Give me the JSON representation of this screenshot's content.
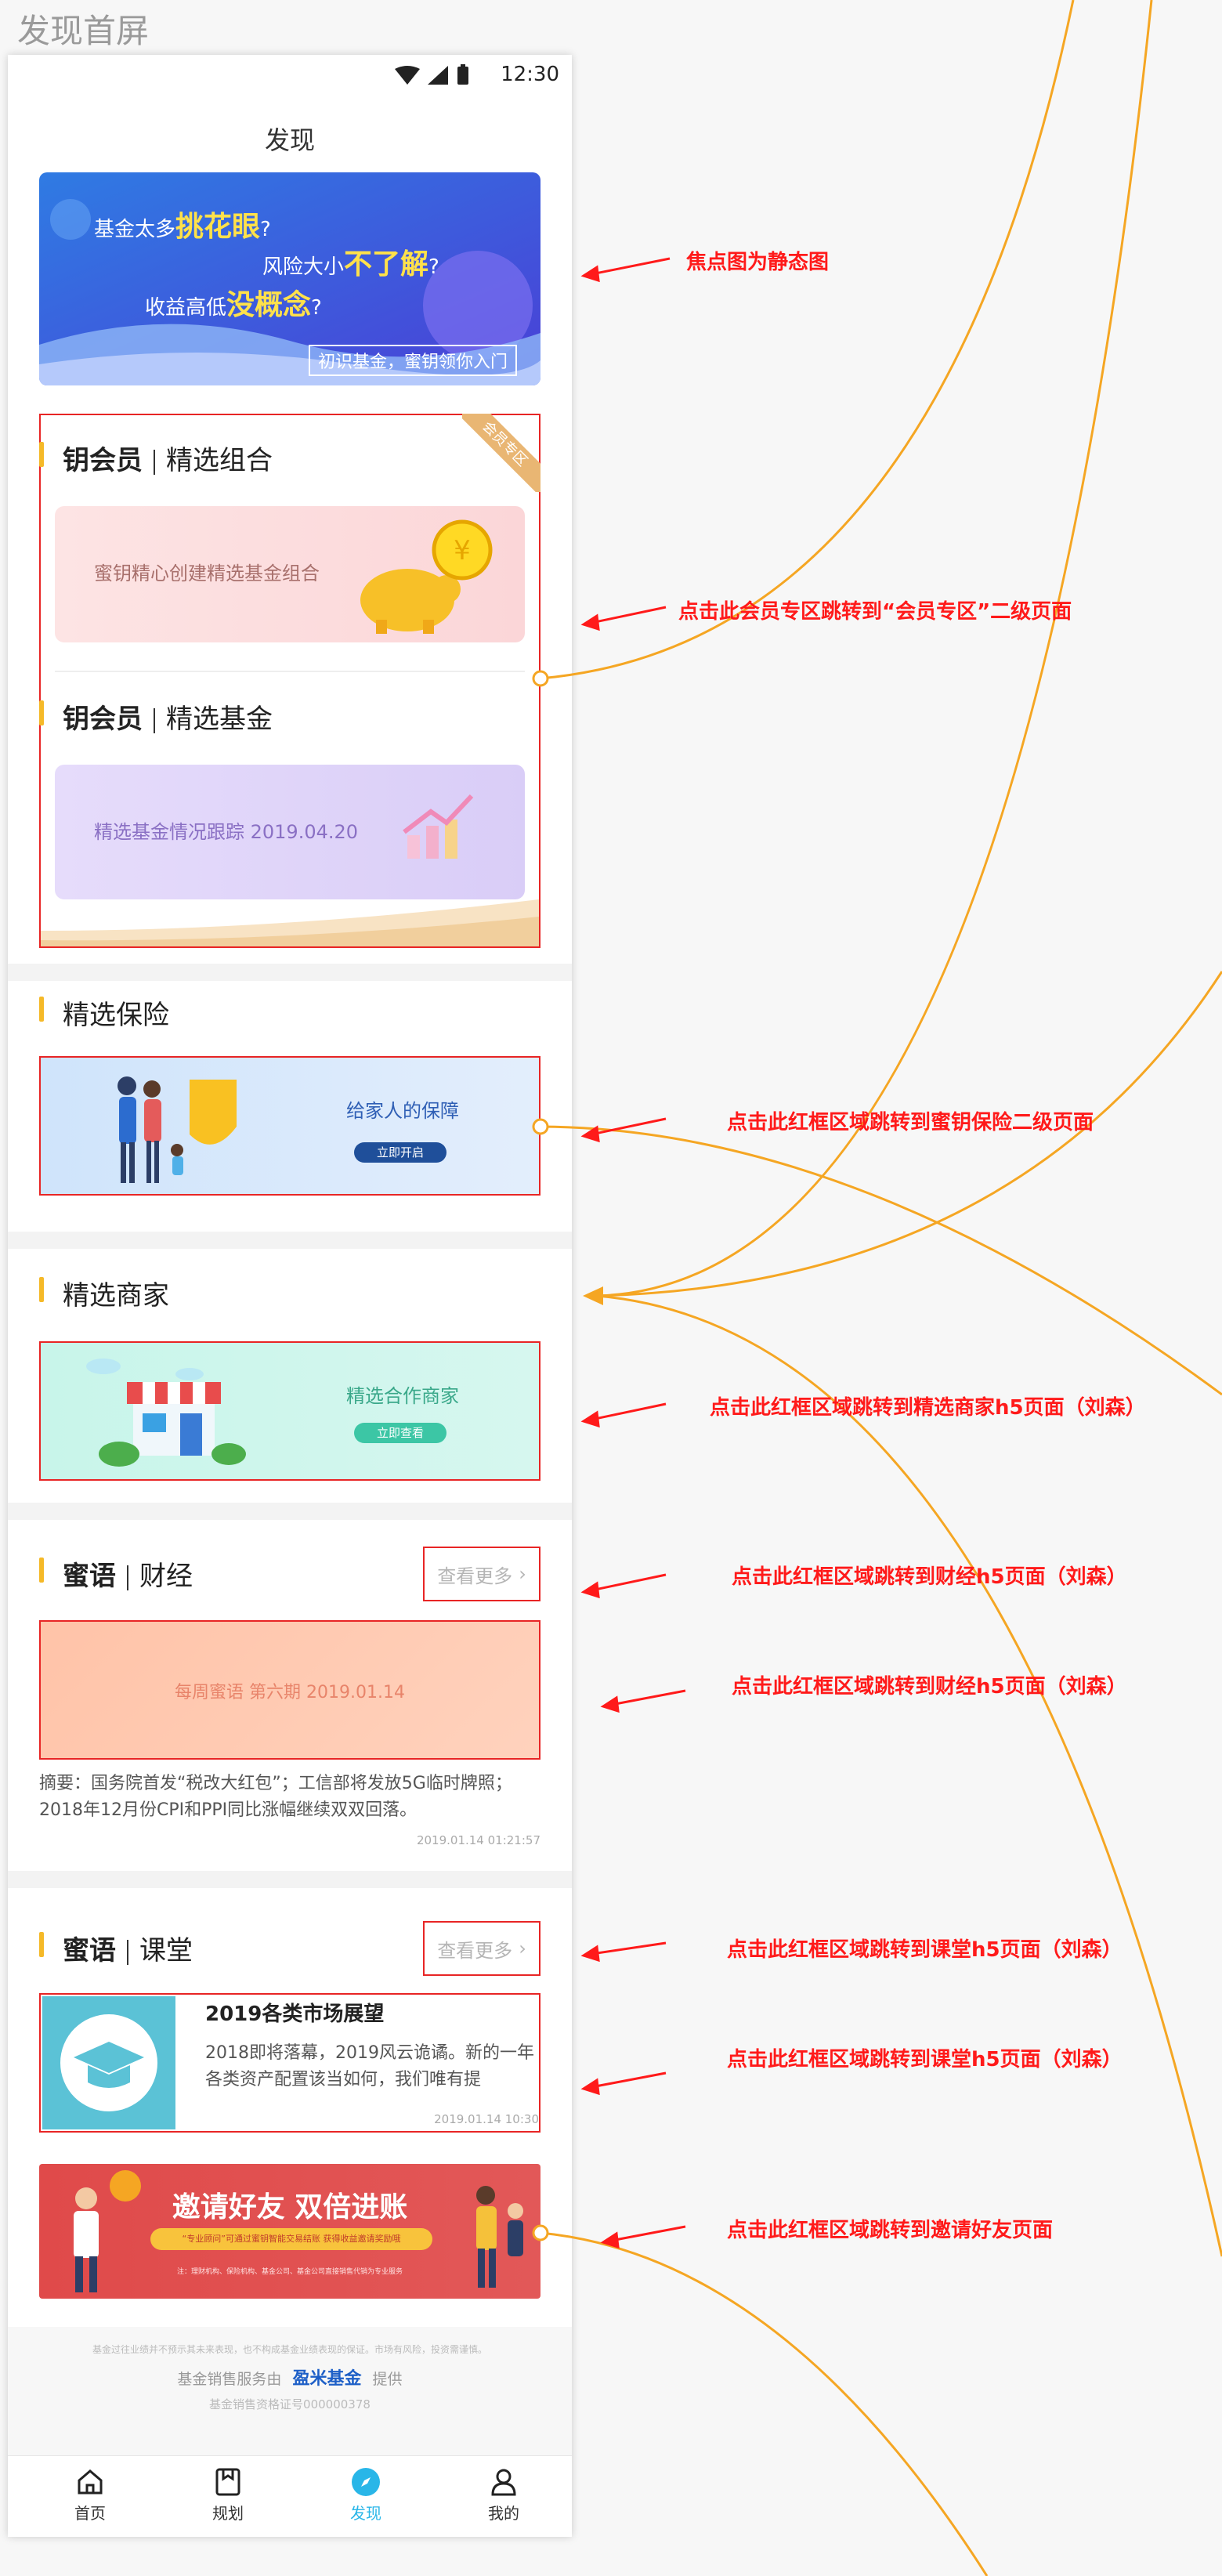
{
  "page_title": "发现首屏",
  "status_bar": {
    "time": "12:30"
  },
  "nav": {
    "title": "发现"
  },
  "banner": {
    "line1_prefix": "基金太多",
    "line1_highlight": "挑花眼",
    "line1_suffix": "?",
    "line2_prefix": "风险大小",
    "line2_highlight": "不了解",
    "line2_suffix": "?",
    "line3_prefix": "收益高低",
    "line3_highlight": "没概念",
    "line3_suffix": "?",
    "tag": "初识基金，蜜钥领你入门"
  },
  "member": {
    "ribbon": "会员专区",
    "section1": {
      "brand": "钥会员",
      "title": "精选组合",
      "card_text": "蜜钥精心创建精选基金组合"
    },
    "section2": {
      "brand": "钥会员",
      "title": "精选基金",
      "card_text": "精选基金情况跟踪  2019.04.20"
    }
  },
  "insurance": {
    "title": "精选保险",
    "banner_text": "给家人的保障",
    "banner_button": "立即开启"
  },
  "merchant": {
    "title": "精选商家",
    "banner_text": "精选合作商家",
    "banner_button": "立即查看"
  },
  "finance": {
    "brand": "蜜语",
    "title": "财经",
    "more": "查看更多",
    "card_text": "每周蜜语 第六期 2019.01.14",
    "summary": "摘要：国务院首发“税改大红包”；工信部将发放5G临时牌照；2018年12月份CPI和PPI同比涨幅继续双双回落。",
    "timestamp": "2019.01.14   01:21:57"
  },
  "classroom": {
    "brand": "蜜语",
    "title": "课堂",
    "more": "查看更多",
    "article_title": "2019各类市场展望",
    "article_desc": "2018即将落幕，2019风云诡谲。新的一年各类资产配置该当如何，我们唯有提",
    "timestamp": "2019.01.14   10:30"
  },
  "invite": {
    "title": "邀请好友  双倍进账",
    "sub": "“专业顾问”可通过蜜钥智能交易结账 获得收益邀请奖励哦",
    "fine": "注：理财机构、保险机构、基金公司、基金公司直接销售代销为专业服务"
  },
  "footer": {
    "disclaimer": "基金过往业绩并不预示其未来表现，也不构成基金业绩表现的保证。市场有风险，投资需谨慎。",
    "provider_prefix": "基金销售服务由",
    "provider_brand": "盈米基金",
    "provider_suffix": "提供",
    "license": "基金销售资格证号000000378"
  },
  "tabs": [
    {
      "label": "首页",
      "icon": "home-icon"
    },
    {
      "label": "规划",
      "icon": "plan-icon"
    },
    {
      "label": "发现",
      "icon": "discover-icon"
    },
    {
      "label": "我的",
      "icon": "profile-icon"
    }
  ],
  "annotations": {
    "a1": "焦点图为静态图",
    "a2": "点击此会员专区跳转到“会员专区”二级页面",
    "a3": "点击此红框区域跳转到蜜钥保险二级页面",
    "a4": "点击此红框区域跳转到精选商家h5页面（刘森）",
    "a5": "点击此红框区域跳转到财经h5页面（刘森）",
    "a6": "点击此红框区域跳转到财经h5页面（刘森）",
    "a7": "点击此红框区域跳转到课堂h5页面（刘森）",
    "a8": "点击此红框区域跳转到课堂h5页面（刘森）",
    "a9": "点击此红框区域跳转到邀请好友页面"
  },
  "colors": {
    "accent_yellow": "#f5b928",
    "annotation_red": "#ff1a1a",
    "connector_orange": "#f5a623",
    "tab_active": "#29b6e8"
  }
}
